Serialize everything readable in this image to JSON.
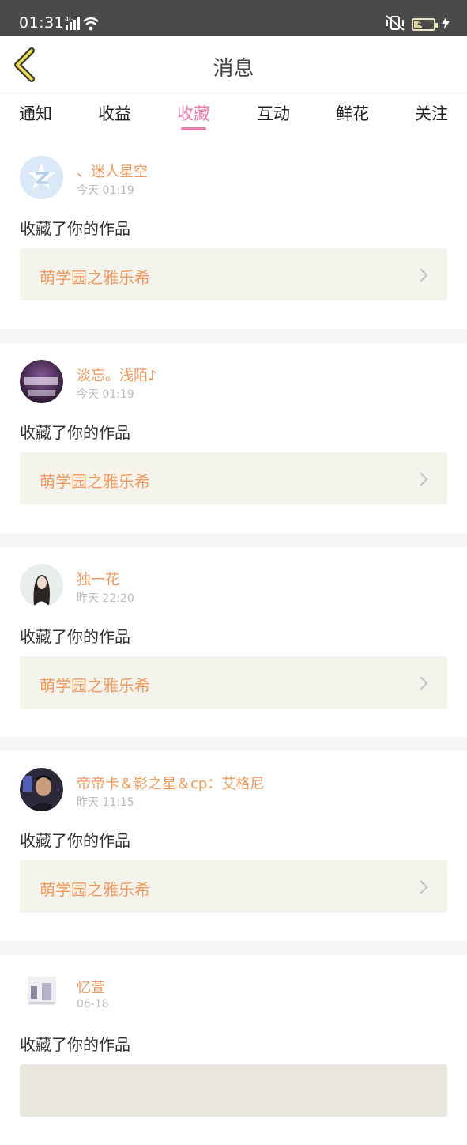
{
  "status_bar": {
    "time": "01:31",
    "network": "4G",
    "battery": "41"
  },
  "header": {
    "title": "消息"
  },
  "tabs": [
    {
      "label": "通知",
      "active": false
    },
    {
      "label": "收益",
      "active": false
    },
    {
      "label": "收藏",
      "active": true
    },
    {
      "label": "互动",
      "active": false
    },
    {
      "label": "鲜花",
      "active": false
    },
    {
      "label": "关注",
      "active": false
    }
  ],
  "colors": {
    "accent": "#e97fae",
    "name": "#ef9a5f",
    "work_bg": "#f5f4ec",
    "status_bg": "#4a4a4a"
  },
  "messages": [
    {
      "user": "、迷人星空",
      "time": "今天 01:19",
      "action": "收藏了你的作品",
      "work": "萌学园之雅乐希",
      "avatar": "qq-default-avatar"
    },
    {
      "user": "淡忘。浅陌♪",
      "time": "今天 01:19",
      "action": "收藏了你的作品",
      "work": "萌学园之雅乐希",
      "avatar": "photo-avatar"
    },
    {
      "user": "独一花",
      "time": "昨天 22:20",
      "action": "收藏了你的作品",
      "work": "萌学园之雅乐希",
      "avatar": "photo-avatar"
    },
    {
      "user": "帝帝卡＆影之星＆cp：艾格尼",
      "time": "昨天 11:15",
      "action": "收藏了你的作品",
      "work": "萌学园之雅乐希",
      "avatar": "photo-avatar"
    },
    {
      "user": "忆萱",
      "time": "06-18",
      "action": "收藏了你的作品",
      "work": "",
      "avatar": "photo-avatar"
    }
  ]
}
